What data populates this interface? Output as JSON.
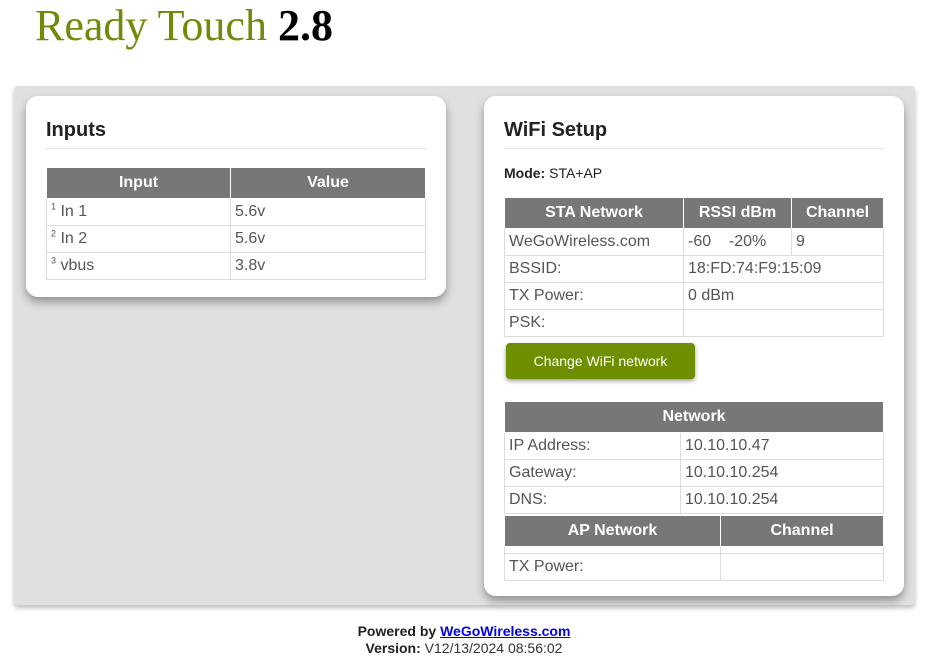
{
  "header": {
    "title": "Ready Touch",
    "version": "2.8"
  },
  "inputs": {
    "heading": "Inputs",
    "columns": [
      "Input",
      "Value"
    ],
    "rows": [
      {
        "num": "1",
        "name": "In 1",
        "value": "5.6v"
      },
      {
        "num": "2",
        "name": "In 2",
        "value": "5.6v"
      },
      {
        "num": "3",
        "name": "vbus",
        "value": "3.8v"
      }
    ]
  },
  "wifi": {
    "heading": "WiFi Setup",
    "mode_label": "Mode:",
    "mode_value": "STA+AP",
    "sta": {
      "columns": [
        "STA Network",
        "RSSI dBm",
        "Channel"
      ],
      "network": "WeGoWireless.com",
      "rssi": "-60    -20%",
      "channel": "9",
      "bssid_label": "BSSID:",
      "bssid": "18:FD:74:F9:15:09",
      "txpower_label": "TX Power:",
      "txpower": "0 dBm",
      "psk_label": "PSK:",
      "psk": ""
    },
    "change_button": "Change WiFi network",
    "network": {
      "heading": "Network",
      "ip_label": "IP Address:",
      "ip": "10.10.10.47",
      "gateway_label": "Gateway:",
      "gateway": "10.10.10.254",
      "dns_label": "DNS:",
      "dns": "10.10.10.254"
    },
    "ap": {
      "columns": [
        "AP Network",
        "Channel"
      ],
      "txpower_label": "TX Power:",
      "txpower": ""
    }
  },
  "footer": {
    "powered_label": "Powered by",
    "link_text": "WeGoWireless.com",
    "version_label": "Version:",
    "version_value": "V12/13/2024 08:56:02"
  },
  "colors": {
    "brand_green": "#6e8c0a",
    "button_green": "#6e8f00",
    "table_header": "#777777",
    "panel_bg": "#e0e0e0"
  }
}
